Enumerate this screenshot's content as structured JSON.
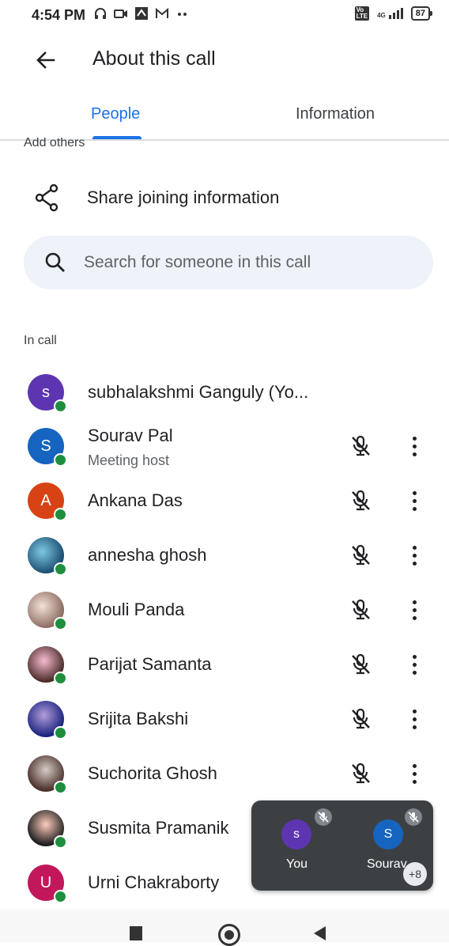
{
  "status_bar": {
    "time": "4:54 PM",
    "network": "4G",
    "battery": "87"
  },
  "header": {
    "title": "About this call"
  },
  "tabs": [
    {
      "label": "People",
      "selected": true
    },
    {
      "label": "Information",
      "selected": false
    }
  ],
  "add_others_label": "Add others",
  "share": {
    "label": "Share joining information"
  },
  "search": {
    "placeholder": "Search for someone in this call"
  },
  "section_label": "In call",
  "participants": [
    {
      "name": "subhalakshmi Ganguly (Yo...",
      "initial": "s",
      "color": "#5e35b1",
      "photo": false,
      "muted_icon": false,
      "more_menu": false
    },
    {
      "name": "Sourav Pal",
      "subtitle": "Meeting host",
      "initial": "S",
      "color": "#1565c0",
      "photo": false,
      "muted_icon": true,
      "more_menu": true
    },
    {
      "name": "Ankana Das",
      "initial": "A",
      "color": "#d84315",
      "photo": false,
      "muted_icon": true,
      "more_menu": true
    },
    {
      "name": "annesha ghosh",
      "photo": true,
      "muted_icon": true,
      "more_menu": true
    },
    {
      "name": "Mouli Panda",
      "photo": true,
      "muted_icon": true,
      "more_menu": true
    },
    {
      "name": "Parijat Samanta",
      "photo": true,
      "muted_icon": true,
      "more_menu": true
    },
    {
      "name": "Srijita Bakshi",
      "photo": true,
      "muted_icon": true,
      "more_menu": true
    },
    {
      "name": "Suchorita Ghosh",
      "photo": true,
      "muted_icon": true,
      "more_menu": true
    },
    {
      "name": "Susmita Pramanik",
      "photo": true,
      "muted_icon": false,
      "more_menu": false
    },
    {
      "name": "Urni Chakraborty",
      "initial": "U",
      "color": "#c2185b",
      "photo": false,
      "muted_icon": false,
      "more_menu": false
    }
  ],
  "pip": {
    "tiles": [
      {
        "name": "You",
        "initial": "s",
        "color": "#5e35b1"
      },
      {
        "name": "Sourav",
        "initial": "S",
        "color": "#1565c0"
      }
    ],
    "more_count": "+8"
  },
  "colors": {
    "accent": "#1a73e8",
    "online": "#1e8e3e"
  },
  "icons": [
    "arrow-back-icon",
    "share-icon",
    "search-icon",
    "mic-off-icon",
    "more-vert-icon"
  ]
}
